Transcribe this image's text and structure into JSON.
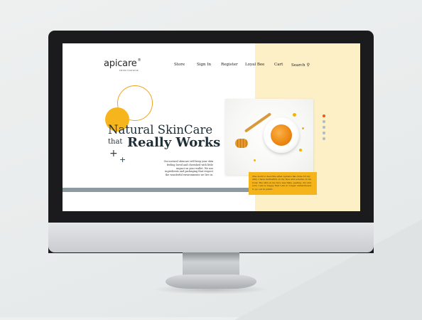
{
  "brand": {
    "name": "apicare",
    "registered": "®",
    "tagline": "FROM OURHIVE"
  },
  "nav": {
    "items": [
      {
        "label": "Store"
      },
      {
        "label": "Sign In"
      },
      {
        "label": "Register"
      },
      {
        "label": "Loyal Bee"
      },
      {
        "label": "Cart"
      },
      {
        "label": "Search",
        "icon": "search-icon"
      }
    ]
  },
  "hero": {
    "headline_line1": "Natural SkinCare",
    "headline_that": "that",
    "headline_line2": "Really Works",
    "decor_symbol": "+",
    "body": "Our natural skincare will keep your skin feeling loved and cherished with little impact on your wallet. We use ingredients and packaging that respect the wonderful environments we live in."
  },
  "testimonial": {
    "text": "One word to describe what Apicare has done for my skin, I have dermatitis on my face and eczema on my body. The skin on my face was flaky, peeling, dry and sore. I am so happy that I am no longer embarrassed to go out in public."
  },
  "carousel": {
    "count": 5,
    "active_index": 0
  },
  "colors": {
    "accent": "#f7b51d",
    "panel": "#fdefc6",
    "heading": "#1e2f38",
    "stripe": "#8d9aa1",
    "carousel_active": "#e55b1e",
    "carousel_inactive": "#a9bcc7"
  }
}
